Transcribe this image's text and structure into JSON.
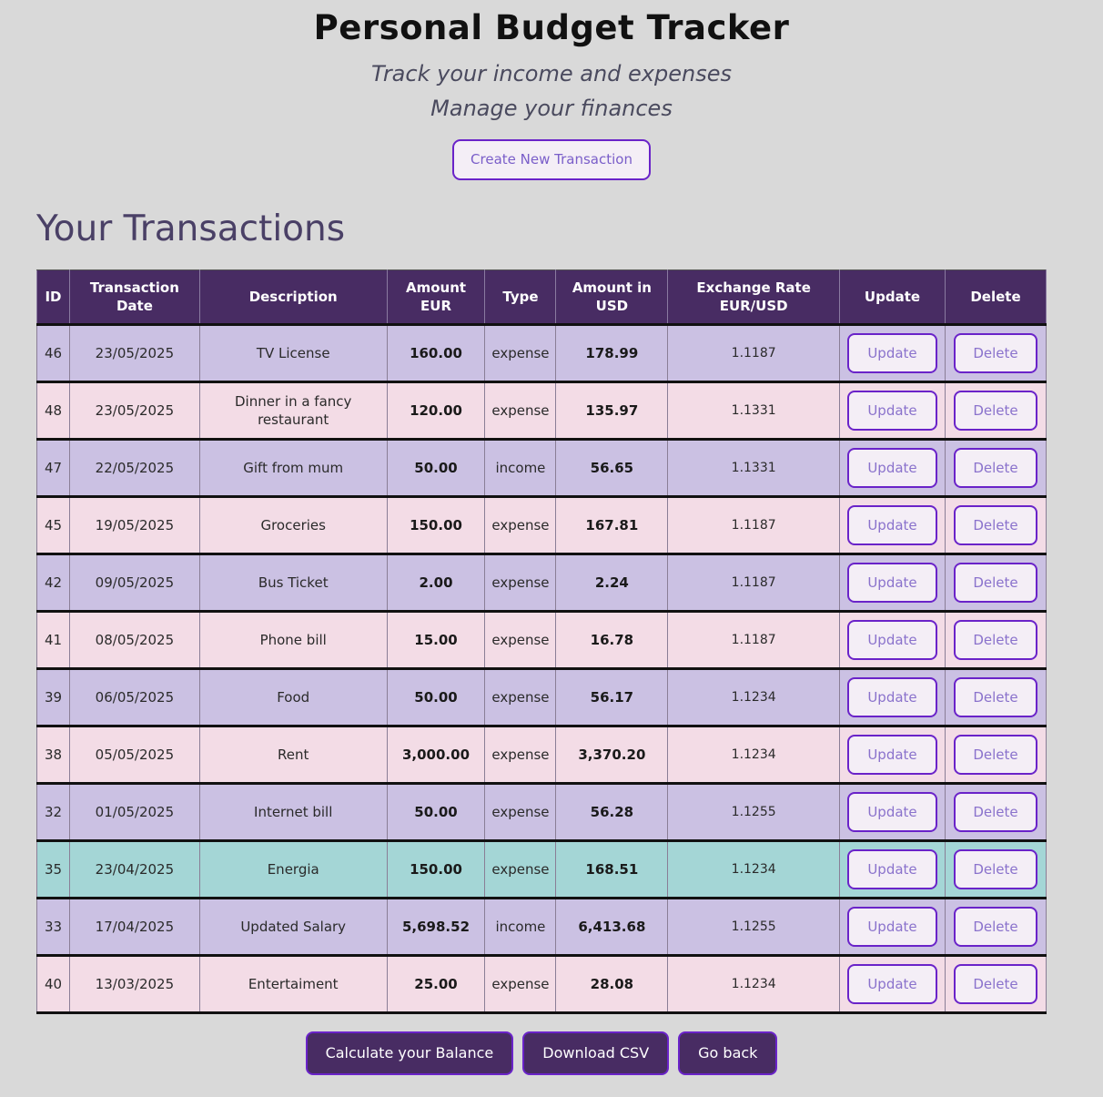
{
  "header": {
    "title": "Personal Budget Tracker",
    "subtitle_1": "Track your income and expenses",
    "subtitle_2": "Manage your finances",
    "create_button": "Create New Transaction"
  },
  "section_title": "Your Transactions",
  "table": {
    "columns": [
      "ID",
      "Transaction Date",
      "Description",
      "Amount EUR",
      "Type",
      "Amount in USD",
      "Exchange Rate EUR/USD",
      "Update",
      "Delete"
    ],
    "update_label": "Update",
    "delete_label": "Delete",
    "rows": [
      {
        "id": "46",
        "date": "23/05/2025",
        "description": "TV License",
        "amount_eur": "160.00",
        "type": "expense",
        "amount_usd": "178.99",
        "rate": "1.1187",
        "color": "#cbc1e3"
      },
      {
        "id": "48",
        "date": "23/05/2025",
        "description": "Dinner in a fancy restaurant",
        "amount_eur": "120.00",
        "type": "expense",
        "amount_usd": "135.97",
        "rate": "1.1331",
        "color": "#f3dce6"
      },
      {
        "id": "47",
        "date": "22/05/2025",
        "description": "Gift from mum",
        "amount_eur": "50.00",
        "type": "income",
        "amount_usd": "56.65",
        "rate": "1.1331",
        "color": "#cbc1e3"
      },
      {
        "id": "45",
        "date": "19/05/2025",
        "description": "Groceries",
        "amount_eur": "150.00",
        "type": "expense",
        "amount_usd": "167.81",
        "rate": "1.1187",
        "color": "#f3dce6"
      },
      {
        "id": "42",
        "date": "09/05/2025",
        "description": "Bus Ticket",
        "amount_eur": "2.00",
        "type": "expense",
        "amount_usd": "2.24",
        "rate": "1.1187",
        "color": "#cbc1e3"
      },
      {
        "id": "41",
        "date": "08/05/2025",
        "description": "Phone bill",
        "amount_eur": "15.00",
        "type": "expense",
        "amount_usd": "16.78",
        "rate": "1.1187",
        "color": "#f3dce6"
      },
      {
        "id": "39",
        "date": "06/05/2025",
        "description": "Food",
        "amount_eur": "50.00",
        "type": "expense",
        "amount_usd": "56.17",
        "rate": "1.1234",
        "color": "#cbc1e3"
      },
      {
        "id": "38",
        "date": "05/05/2025",
        "description": "Rent",
        "amount_eur": "3,000.00",
        "type": "expense",
        "amount_usd": "3,370.20",
        "rate": "1.1234",
        "color": "#f3dce6"
      },
      {
        "id": "32",
        "date": "01/05/2025",
        "description": "Internet bill",
        "amount_eur": "50.00",
        "type": "expense",
        "amount_usd": "56.28",
        "rate": "1.1255",
        "color": "#cbc1e3"
      },
      {
        "id": "35",
        "date": "23/04/2025",
        "description": "Energia",
        "amount_eur": "150.00",
        "type": "expense",
        "amount_usd": "168.51",
        "rate": "1.1234",
        "color": "#a4d6d6"
      },
      {
        "id": "33",
        "date": "17/04/2025",
        "description": "Updated Salary",
        "amount_eur": "5,698.52",
        "type": "income",
        "amount_usd": "6,413.68",
        "rate": "1.1255",
        "color": "#cbc1e3"
      },
      {
        "id": "40",
        "date": "13/03/2025",
        "description": "Entertaiment",
        "amount_eur": "25.00",
        "type": "expense",
        "amount_usd": "28.08",
        "rate": "1.1234",
        "color": "#f3dce6"
      }
    ]
  },
  "footer": {
    "balance_button": "Calculate your Balance",
    "csv_button": "Download CSV",
    "back_button": "Go back"
  },
  "colors": {
    "header_bg": "#482c63",
    "accent_border": "#6a23c9",
    "row_purple": "#cbc1e3",
    "row_pink": "#f3dce6",
    "row_teal": "#a4d6d6",
    "page_bg": "#d9d9d9"
  }
}
